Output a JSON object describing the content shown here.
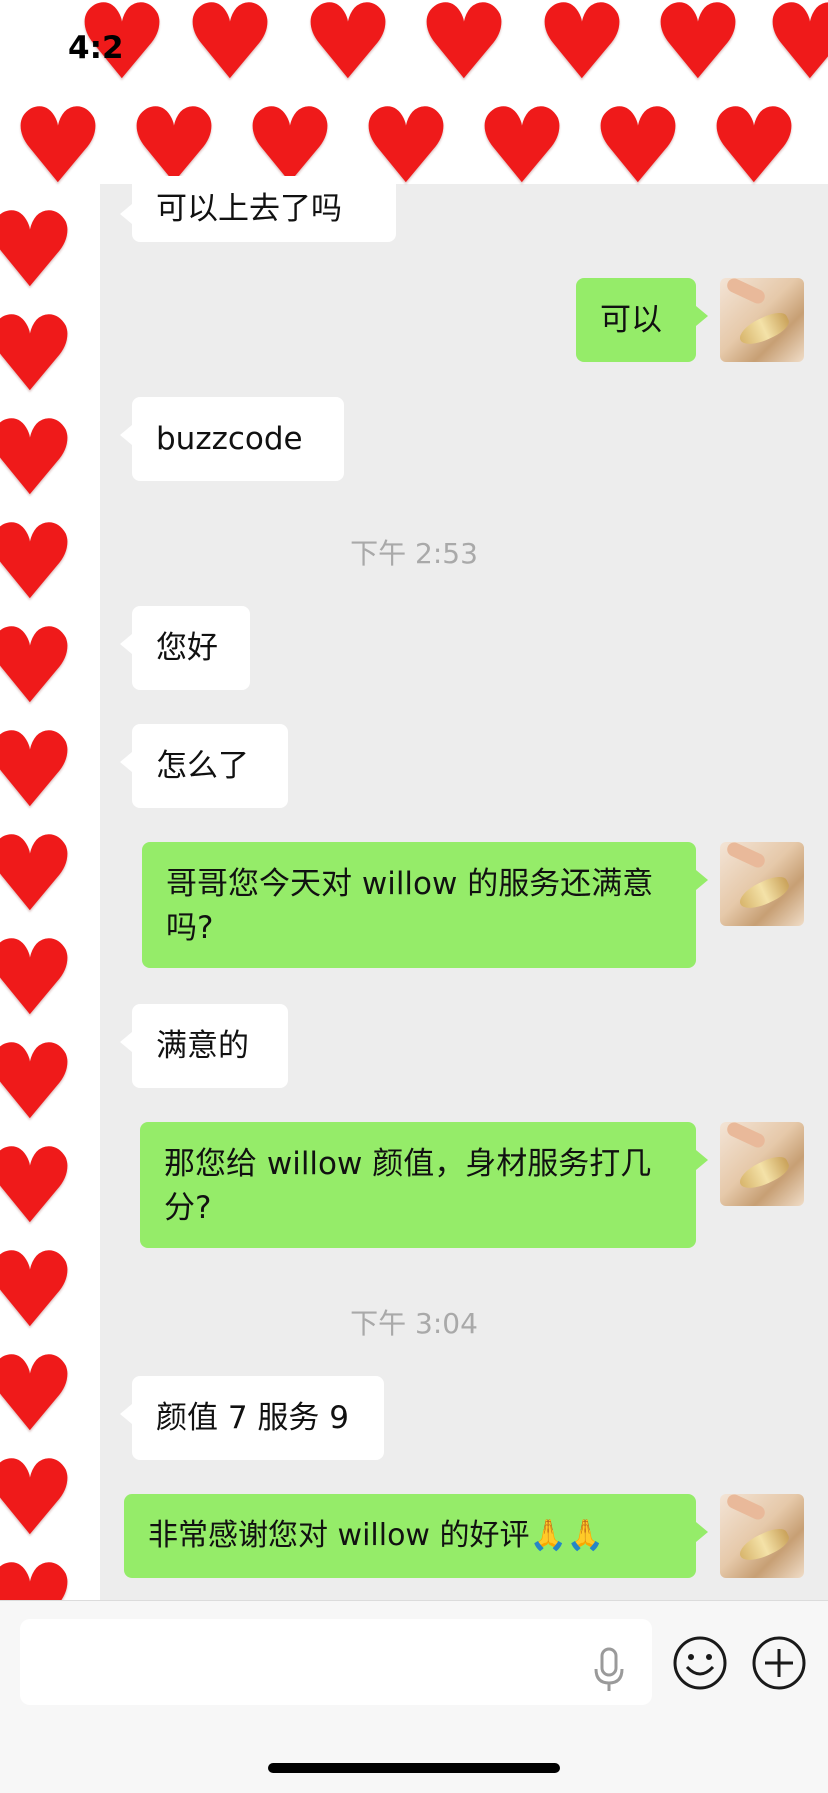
{
  "status_bar": {
    "time": "4:2"
  },
  "colors": {
    "self_bubble": "#95ec69",
    "other_bubble": "#ffffff",
    "background": "#ededed",
    "heart": "#ef1a1a"
  },
  "messages": [
    {
      "side": "left",
      "text": "可以上去了吗"
    },
    {
      "side": "right",
      "text": "可以"
    },
    {
      "side": "left",
      "text": "buzzcode"
    },
    {
      "type": "timestamp",
      "text": "下午 2:53"
    },
    {
      "side": "left",
      "text": "您好"
    },
    {
      "side": "left",
      "text": "怎么了"
    },
    {
      "side": "right",
      "text": "哥哥您今天对 willow 的服务还满意吗?"
    },
    {
      "side": "left",
      "text": "满意的"
    },
    {
      "side": "right",
      "text": "那您给 willow 颜值，身材服务打几分?"
    },
    {
      "type": "timestamp",
      "text": "下午 3:04"
    },
    {
      "side": "left",
      "text": "颜值 7 服务 9"
    },
    {
      "side": "right",
      "text": "非常感谢您对 willow 的好评🙏🙏"
    }
  ],
  "input": {
    "placeholder": "",
    "mic_icon": "mic-icon",
    "emoji_icon": "emoji-icon",
    "plus_icon": "plus-icon"
  },
  "decoration": {
    "sticker": "heart-icon"
  }
}
